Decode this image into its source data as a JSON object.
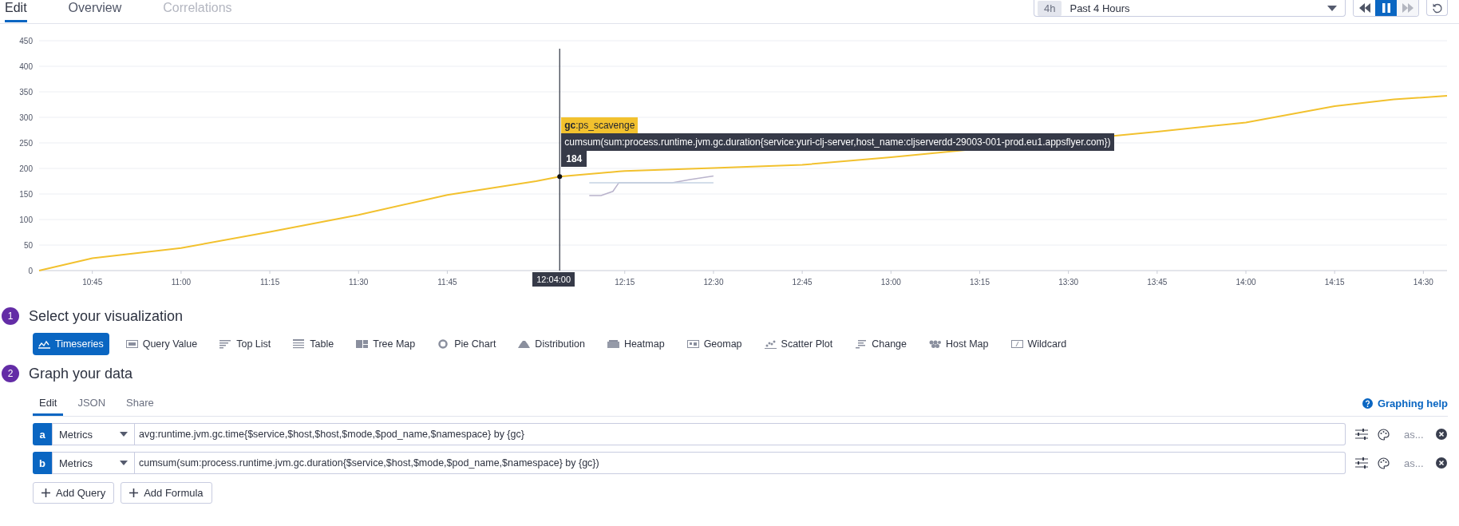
{
  "tabs": [
    {
      "label": "Edit",
      "selected": true,
      "disabled": false
    },
    {
      "label": "Overview",
      "selected": false,
      "disabled": false
    },
    {
      "label": "Correlations",
      "selected": false,
      "disabled": true
    }
  ],
  "time_range": {
    "badge": "4h",
    "label": "Past 4 Hours"
  },
  "playback": [
    {
      "kind": "rewind",
      "selected": false,
      "disabled": false
    },
    {
      "kind": "pause",
      "selected": true,
      "disabled": false
    },
    {
      "kind": "forward",
      "selected": false,
      "disabled": true
    }
  ],
  "chart": {
    "chart_data": {
      "type": "line",
      "grid": true,
      "x": [
        38160,
        38700,
        39600,
        40500,
        41400,
        42300,
        43200,
        43440,
        43740,
        43860,
        43980,
        44040,
        44100,
        44580,
        44760,
        45000,
        45900,
        46800,
        49500,
        50400,
        51300,
        51900,
        52440
      ],
      "series": [
        {
          "color": "#f2c12e",
          "values": [
            0,
            24,
            44,
            76,
            109,
            148,
            175,
            184,
            189,
            191,
            193,
            194,
            195,
            198,
            199,
            201,
            207,
            222,
            272,
            290,
            322,
            335,
            342
          ]
        },
        {
          "color": "#b9b3cc",
          "values": [
            null,
            null,
            null,
            null,
            null,
            null,
            null,
            null,
            147,
            147,
            155,
            172,
            172,
            172,
            178,
            185,
            null,
            null,
            null,
            null,
            null,
            null,
            null
          ]
        },
        {
          "color": "#c5d3e3",
          "values": [
            null,
            null,
            null,
            null,
            null,
            null,
            null,
            null,
            172,
            172,
            172,
            172,
            172,
            172,
            172,
            172,
            null,
            null,
            null,
            null,
            null,
            null,
            null
          ]
        }
      ],
      "xlim": [
        38160,
        52440
      ],
      "ylim": [
        0,
        450
      ],
      "yticks": [
        0,
        50,
        100,
        150,
        200,
        250,
        300,
        350,
        400,
        450
      ],
      "xticks": [
        {
          "value": 38700,
          "label": "10:45"
        },
        {
          "value": 39600,
          "label": "11:00"
        },
        {
          "value": 40500,
          "label": "11:15"
        },
        {
          "value": 41400,
          "label": "11:30"
        },
        {
          "value": 42300,
          "label": "11:45"
        },
        {
          "value": 44100,
          "label": "12:15"
        },
        {
          "value": 45000,
          "label": "12:30"
        },
        {
          "value": 45900,
          "label": "12:45"
        },
        {
          "value": 46800,
          "label": "13:00"
        },
        {
          "value": 47700,
          "label": "13:15"
        },
        {
          "value": 48600,
          "label": "13:30"
        },
        {
          "value": 49500,
          "label": "13:45"
        },
        {
          "value": 50400,
          "label": "14:00"
        },
        {
          "value": 51300,
          "label": "14:15"
        },
        {
          "value": 52200,
          "label": "14:30"
        }
      ],
      "ref_lines": [
        {
          "axis": "x",
          "value": 43440
        }
      ]
    },
    "crosshair_label": "12:04:00",
    "tooltip": {
      "tag": "**gc**:ps_scavenge",
      "query": "cumsum(sum:process.runtime.jvm.gc.duration{service:yuri-clj-server,host_name:cljserverdd-29003-001-prod.eu1.appsflyer.com})",
      "value": "184"
    }
  },
  "steps": [
    {
      "number": "1",
      "title": "Select your visualization"
    },
    {
      "number": "2",
      "title": "Graph your data"
    }
  ],
  "visualizations": [
    {
      "kind": "timeseries",
      "label": "Timeseries",
      "selected": true
    },
    {
      "kind": "query_value",
      "label": "Query Value",
      "selected": false
    },
    {
      "kind": "toplist",
      "label": "Top List",
      "selected": false
    },
    {
      "kind": "table",
      "label": "Table",
      "selected": false
    },
    {
      "kind": "treemap",
      "label": "Tree Map",
      "selected": false
    },
    {
      "kind": "pie",
      "label": "Pie Chart",
      "selected": false
    },
    {
      "kind": "distribution",
      "label": "Distribution",
      "selected": false
    },
    {
      "kind": "heatmap",
      "label": "Heatmap",
      "selected": false
    },
    {
      "kind": "geomap",
      "label": "Geomap",
      "selected": false
    },
    {
      "kind": "scatter",
      "label": "Scatter Plot",
      "selected": false
    },
    {
      "kind": "change",
      "label": "Change",
      "selected": false
    },
    {
      "kind": "hostmap",
      "label": "Host Map",
      "selected": false
    },
    {
      "kind": "wildcard",
      "label": "Wildcard",
      "selected": false
    }
  ],
  "editor_tabs": [
    {
      "label": "Edit",
      "selected": true
    },
    {
      "label": "JSON",
      "selected": false
    },
    {
      "label": "Share",
      "selected": false
    }
  ],
  "help_link": "Graphing help",
  "queries": [
    {
      "letter": "a",
      "source": "Metrics",
      "query": "avg:runtime.jvm.gc.time{$service,$host,$host,$mode,$pod_name,$namespace} by {gc}",
      "alias": "as..."
    },
    {
      "letter": "b",
      "source": "Metrics",
      "query": "cumsum(sum:process.runtime.jvm.gc.duration{$service,$host,$mode,$pod_name,$namespace} by {gc})",
      "alias": "as..."
    }
  ],
  "add_buttons": [
    "Add Query",
    "Add Formula"
  ]
}
